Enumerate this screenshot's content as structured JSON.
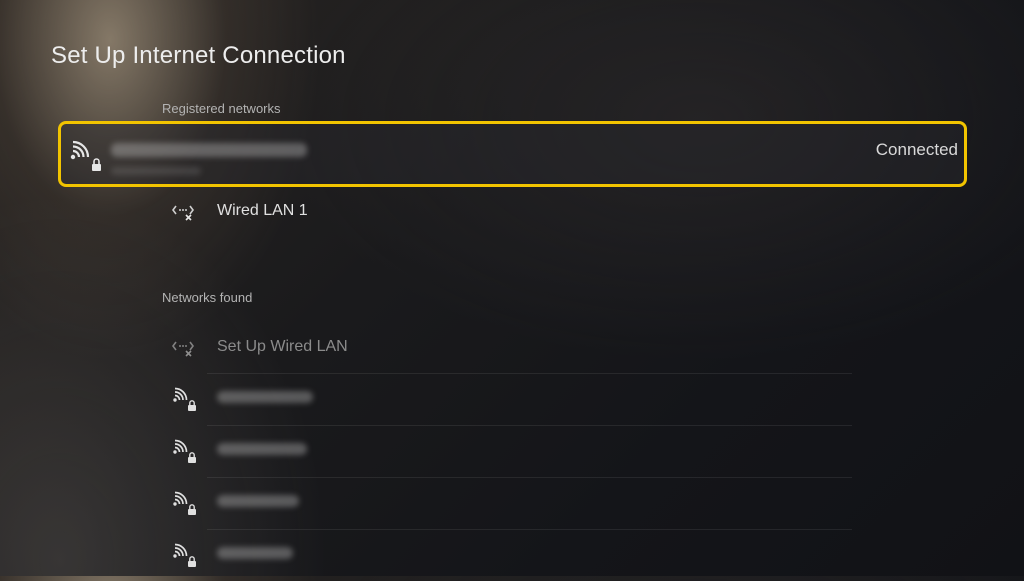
{
  "page": {
    "title": "Set Up Internet Connection"
  },
  "registered": {
    "label": "Registered networks",
    "items": [
      {
        "type": "wifi-secured",
        "name": "",
        "status": "Connected"
      },
      {
        "type": "wired",
        "name": "Wired LAN 1"
      }
    ]
  },
  "found": {
    "label": "Networks found",
    "items": [
      {
        "type": "wired",
        "name": "Set Up Wired LAN"
      },
      {
        "type": "wifi-secured",
        "name": ""
      },
      {
        "type": "wifi-secured",
        "name": ""
      },
      {
        "type": "wifi-secured",
        "name": ""
      },
      {
        "type": "wifi-secured",
        "name": ""
      }
    ]
  },
  "colors": {
    "focus_border": "#f2c400",
    "background": "#141519"
  },
  "icons": {
    "wifi": "wifi-lock-icon",
    "wired": "wired-lan-disconnected-icon"
  }
}
